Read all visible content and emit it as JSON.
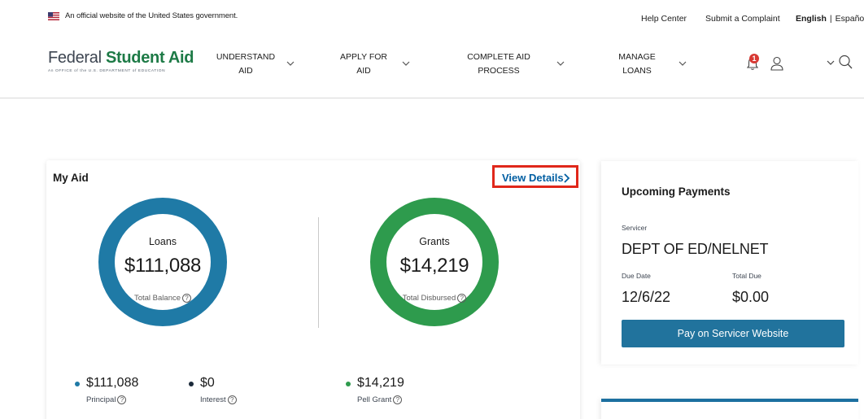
{
  "gov_banner": {
    "text": "An official website of the United States government.",
    "help_center": "Help Center",
    "submit_complaint": "Submit a Complaint",
    "lang_english": "English",
    "lang_sep": "|",
    "lang_spanish": "Español"
  },
  "logo": {
    "part1": "Federal",
    "part2": "Student Aid",
    "tagline": "An OFFICE of the U.S. DEPARTMENT of EDUCATION"
  },
  "nav": {
    "items": [
      {
        "line1": "UNDERSTAND",
        "line2": "AID"
      },
      {
        "line1": "APPLY FOR",
        "line2": "AID"
      },
      {
        "line1": "COMPLETE AID",
        "line2": "PROCESS"
      },
      {
        "line1": "MANAGE",
        "line2": "LOANS"
      }
    ],
    "notification_count": "1",
    "icons": [
      "bell-icon",
      "user-icon",
      "chevron-down-icon",
      "search-icon"
    ]
  },
  "my_aid": {
    "title": "My Aid",
    "view_details": "View Details",
    "loans": {
      "label": "Loans",
      "amount": "$111,088",
      "sublabel": "Total Balance",
      "color": "#1f7aa6"
    },
    "grants": {
      "label": "Grants",
      "amount": "$14,219",
      "sublabel": "Total Disbursed",
      "color": "#2e9b4d"
    },
    "breakdown": [
      {
        "amount": "$111,088",
        "label": "Principal",
        "color": "#1f7aa6"
      },
      {
        "amount": "$0",
        "label": "Interest",
        "color": "#1b2a3a"
      },
      {
        "amount": "$14,219",
        "label": "Pell Grant",
        "color": "#2e9b4d"
      }
    ]
  },
  "payments": {
    "title": "Upcoming Payments",
    "servicer_label": "Servicer",
    "servicer_value": "DEPT OF ED/NELNET",
    "due_date_label": "Due Date",
    "due_date_value": "12/6/22",
    "total_due_label": "Total Due",
    "total_due_value": "$0.00",
    "pay_button": "Pay on Servicer Website"
  },
  "colors": {
    "accent_blue": "#21739d",
    "link_blue": "#005ea2",
    "highlight_red": "#e0271a"
  }
}
